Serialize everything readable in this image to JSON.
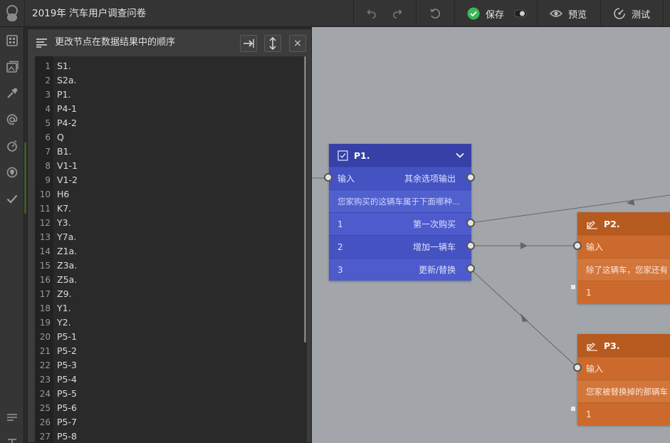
{
  "app": {
    "title": "2019年 汽车用户调查问卷"
  },
  "toolbar": {
    "save_label": "保存",
    "preview_label": "预览",
    "test_label": "测试"
  },
  "dialog": {
    "title": "更改节点在数据结果中的顺序",
    "close_label": "×",
    "lines": [
      {
        "n": "1",
        "t": "S1."
      },
      {
        "n": "2",
        "t": "S2a."
      },
      {
        "n": "3",
        "t": "P1."
      },
      {
        "n": "4",
        "t": "P4-1"
      },
      {
        "n": "5",
        "t": "P4-2"
      },
      {
        "n": "6",
        "t": "Q"
      },
      {
        "n": "7",
        "t": "B1."
      },
      {
        "n": "8",
        "t": "V1-1"
      },
      {
        "n": "9",
        "t": "V1-2"
      },
      {
        "n": "10",
        "t": "H6"
      },
      {
        "n": "11",
        "t": "K7."
      },
      {
        "n": "12",
        "t": "Y3."
      },
      {
        "n": "13",
        "t": "Y7a."
      },
      {
        "n": "14",
        "t": "Z1a."
      },
      {
        "n": "15",
        "t": "Z3a."
      },
      {
        "n": "16",
        "t": "Z5a."
      },
      {
        "n": "17",
        "t": "Z9."
      },
      {
        "n": "18",
        "t": "Y1."
      },
      {
        "n": "19",
        "t": "Y2."
      },
      {
        "n": "20",
        "t": "P5-1"
      },
      {
        "n": "21",
        "t": "P5-2"
      },
      {
        "n": "22",
        "t": "P5-3"
      },
      {
        "n": "23",
        "t": "P5-4"
      },
      {
        "n": "24",
        "t": "P5-5"
      },
      {
        "n": "25",
        "t": "P5-6"
      },
      {
        "n": "26",
        "t": "P5-7"
      },
      {
        "n": "27",
        "t": "P5-8"
      }
    ]
  },
  "nodes": {
    "p1": {
      "title": "P1.",
      "input_label": "输入",
      "other_output_label": "其余选项输出",
      "question": "您家购买的这辆车属于下面哪种...",
      "options": [
        {
          "code": "1",
          "label": "第一次购买"
        },
        {
          "code": "2",
          "label": "增加一辆车"
        },
        {
          "code": "3",
          "label": "更新/替换"
        }
      ]
    },
    "p2": {
      "title": "P2.",
      "input_label": "输入",
      "question": "除了这辆车，您家还有",
      "option_code": "1"
    },
    "p3": {
      "title": "P3.",
      "input_label": "输入",
      "question": "您家被替换掉的那辆车",
      "option_code": "1"
    }
  },
  "icons": {
    "logo": "tenant-avatar-icon",
    "undo": "undo-icon",
    "redo": "redo-icon",
    "history": "history-icon",
    "save": "check-circle-icon",
    "toggle": "toggle-icon",
    "preview": "eye-icon",
    "test": "test-icon"
  },
  "colors": {
    "accent_green": "#3bb75a",
    "node_blue": "#4553c2",
    "node_orange": "#cc6a2d",
    "canvas": "#a2a6aa"
  }
}
